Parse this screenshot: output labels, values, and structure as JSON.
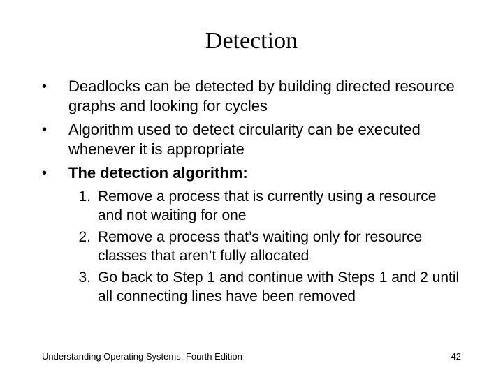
{
  "title": "Detection",
  "bullets": [
    {
      "mark": "•",
      "text": "Deadlocks can be detected by building directed resource graphs and looking for cycles",
      "bold": false
    },
    {
      "mark": "•",
      "text": "Algorithm used to detect circularity can be executed whenever it is appropriate",
      "bold": false
    },
    {
      "mark": "•",
      "text": "The detection algorithm:",
      "bold": true
    }
  ],
  "steps": [
    {
      "num": "1.",
      "text": "Remove a process that is currently using a resource and not waiting for one"
    },
    {
      "num": "2.",
      "text": "Remove a process that’s waiting only for resource classes that aren’t fully allocated"
    },
    {
      "num": "3.",
      "text": "Go back to Step 1 and continue with Steps 1 and 2 until all connecting lines have been removed"
    }
  ],
  "footer_left": "Understanding Operating Systems, Fourth Edition",
  "footer_right": "42"
}
